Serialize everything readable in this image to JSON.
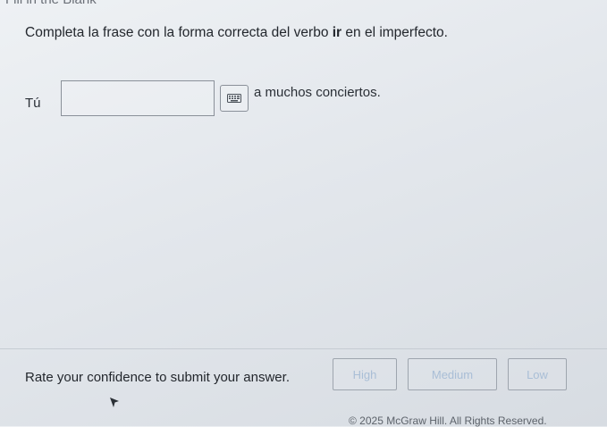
{
  "header": {
    "partial_title": "Fill in the Blank"
  },
  "question": {
    "instructions_before": "Completa la frase con la forma correcta del verbo ",
    "verb": "ir",
    "instructions_after": " en el imperfecto.",
    "subject": "Tú",
    "answer_value": "",
    "sentence_rest": "a muchos conciertos.",
    "keyboard_icon": "keyboard-icon"
  },
  "confidence": {
    "label": "Rate your confidence to submit your answer.",
    "buttons": {
      "high": "High",
      "medium": "Medium",
      "low": "Low"
    },
    "disabled_color": "#a9bed6"
  },
  "footer": {
    "copyright": "© 2025 McGraw Hill. All Rights Reserved."
  }
}
